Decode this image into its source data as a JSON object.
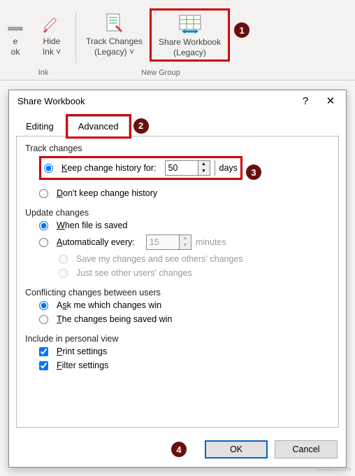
{
  "ribbon": {
    "partial_btn1_l1": "e",
    "partial_btn1_l2": "ok",
    "hide_ink_l1": "Hide",
    "hide_ink_l2": "Ink ˅",
    "track_changes_l1": "Track Changes",
    "track_changes_l2": "(Legacy) ˅",
    "share_wb_l1": "Share Workbook",
    "share_wb_l2": "(Legacy)",
    "group_ink": "Ink",
    "group_new": "New Group"
  },
  "dialog": {
    "title": "Share Workbook",
    "help": "?",
    "close": "✕",
    "tabs": {
      "editing": "Editing",
      "advanced": "Advanced"
    },
    "track": {
      "title": "Track changes",
      "keep_pre": "Keep change history for:",
      "days_val": "50",
      "days_suffix": "days",
      "dont_pre": "Don't keep change history"
    },
    "update": {
      "title": "Update changes",
      "when_saved": "When file is saved",
      "auto_pre": "Automatically every:",
      "auto_val": "15",
      "minutes": "minutes",
      "save_mine": "Save my changes and see others' changes",
      "see_others": "Just see other users' changes"
    },
    "conflict": {
      "title": "Conflicting changes between users",
      "ask": "Ask me which changes win",
      "saved_win": "The changes being saved win"
    },
    "personal": {
      "title": "Include in personal view",
      "print": "Print settings",
      "filter": "Filter settings"
    },
    "buttons": {
      "ok": "OK",
      "cancel": "Cancel"
    }
  },
  "badges": {
    "b1": "1",
    "b2": "2",
    "b3": "3",
    "b4": "4"
  },
  "watermark": "wsxdn.com"
}
